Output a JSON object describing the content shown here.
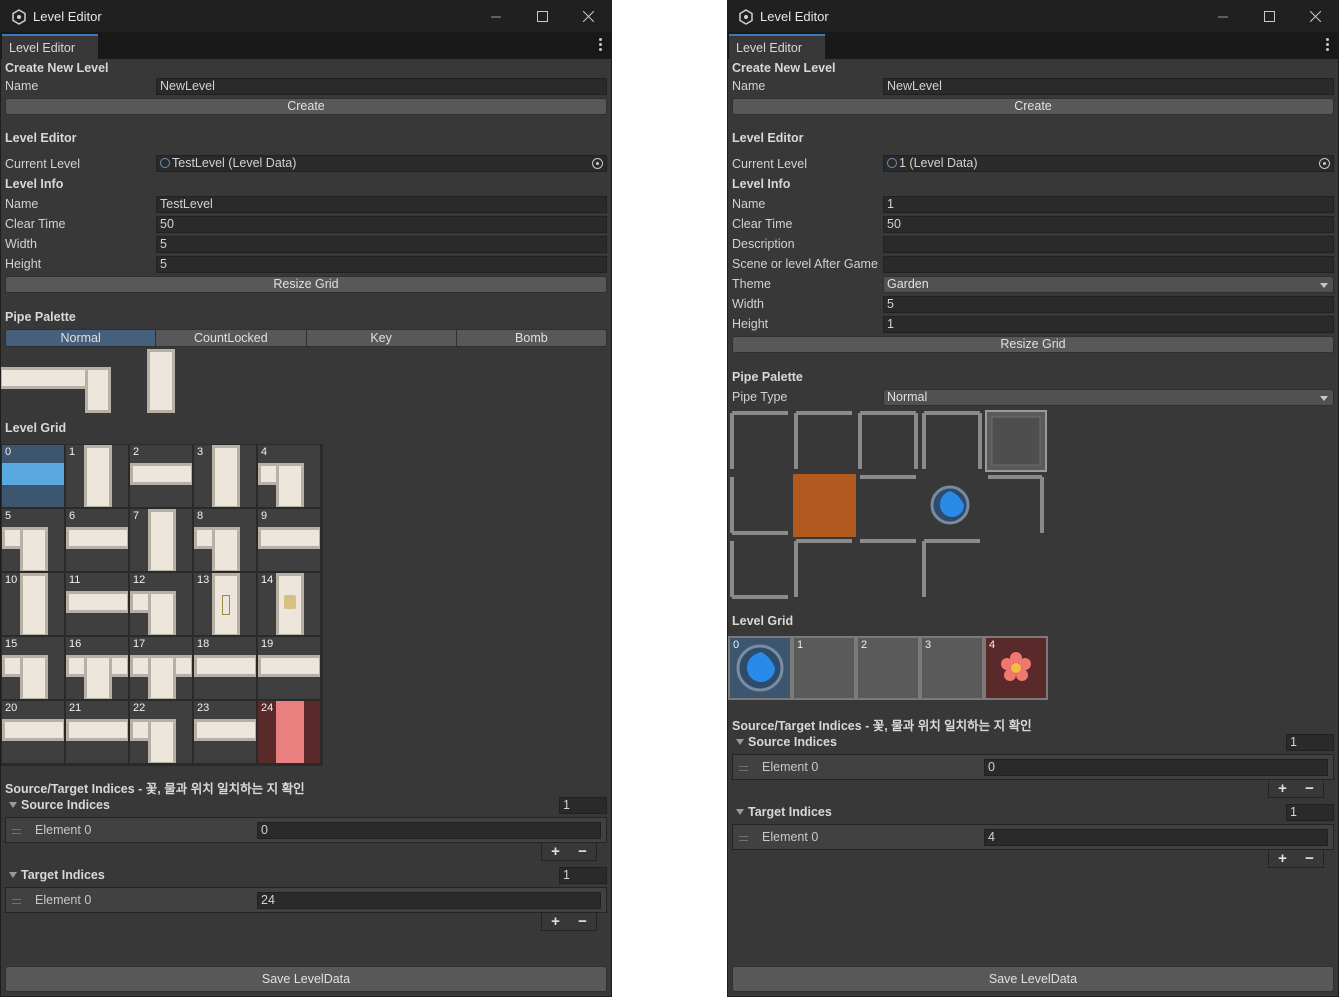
{
  "windows": [
    {
      "title": "Level Editor",
      "tab": "Level Editor",
      "create_section": {
        "heading": "Create New Level",
        "name_label": "Name",
        "name_value": "NewLevel",
        "button": "Create"
      },
      "editor_heading": "Level Editor",
      "current_level_label": "Current Level",
      "current_level_value": "TestLevel (Level Data)",
      "info_heading": "Level Info",
      "info_fields": [
        {
          "label": "Name",
          "value": "TestLevel"
        },
        {
          "label": "Clear Time",
          "value": "50"
        },
        {
          "label": "Width",
          "value": "5"
        },
        {
          "label": "Height",
          "value": "5"
        }
      ],
      "resize_button": "Resize Grid",
      "palette_heading": "Pipe Palette",
      "palette_tabs": [
        "Normal",
        "CountLocked",
        "Key",
        "Bomb"
      ],
      "palette_selected": "Normal",
      "grid_heading": "Level Grid",
      "grid_cells": [
        "0",
        "1",
        "2",
        "3",
        "4",
        "5",
        "6",
        "7",
        "8",
        "9",
        "10",
        "11",
        "12",
        "13",
        "14",
        "15",
        "16",
        "17",
        "18",
        "19",
        "20",
        "21",
        "22",
        "23",
        "24"
      ],
      "indices_heading": "Source/Target Indices - 꽃, 물과 위치 일치하는 지 확인",
      "source": {
        "label": "Source Indices",
        "size": "1",
        "element_label": "Element 0",
        "element_value": "0"
      },
      "target": {
        "label": "Target Indices",
        "size": "1",
        "element_label": "Element 0",
        "element_value": "24"
      },
      "save_button": "Save LevelData"
    },
    {
      "title": "Level Editor",
      "tab": "Level Editor",
      "create_section": {
        "heading": "Create New Level",
        "name_label": "Name",
        "name_value": "NewLevel",
        "button": "Create"
      },
      "editor_heading": "Level Editor",
      "current_level_label": "Current Level",
      "current_level_value": "1 (Level Data)",
      "info_heading": "Level Info",
      "info_fields": [
        {
          "label": "Name",
          "value": "1"
        },
        {
          "label": "Clear Time",
          "value": "50"
        },
        {
          "label": "Description",
          "value": ""
        },
        {
          "label": "Scene or level After Game",
          "value": ""
        },
        {
          "label": "Theme",
          "value": "Garden"
        },
        {
          "label": "Width",
          "value": "5"
        },
        {
          "label": "Height",
          "value": "1"
        }
      ],
      "resize_button": "Resize Grid",
      "palette_heading": "Pipe Palette",
      "pipe_type_label": "Pipe Type",
      "pipe_type_value": "Normal",
      "grid_heading": "Level Grid",
      "grid_cells": [
        "0",
        "1",
        "2",
        "3",
        "4"
      ],
      "indices_heading": "Source/Target Indices - 꽃, 물과 위치 일치하는 지 확인",
      "source": {
        "label": "Source Indices",
        "size": "1",
        "element_label": "Element 0",
        "element_value": "0"
      },
      "target": {
        "label": "Target Indices",
        "size": "1",
        "element_label": "Element 0",
        "element_value": "4"
      },
      "save_button": "Save LevelData"
    }
  ],
  "colors": {
    "panel": "#383838",
    "titlebar": "#202020",
    "accent": "#3a79bb",
    "selected_tab": "#46607c",
    "water": "#5aa8e0",
    "target": "#5a2a2a",
    "crate": "#b05a20"
  },
  "icons": [
    "unity-icon",
    "minimize-icon",
    "maximize-icon",
    "close-icon",
    "kebab-menu-icon",
    "object-picker-icon",
    "key-icon",
    "lock-icon",
    "water-drop-icon",
    "flower-icon"
  ]
}
